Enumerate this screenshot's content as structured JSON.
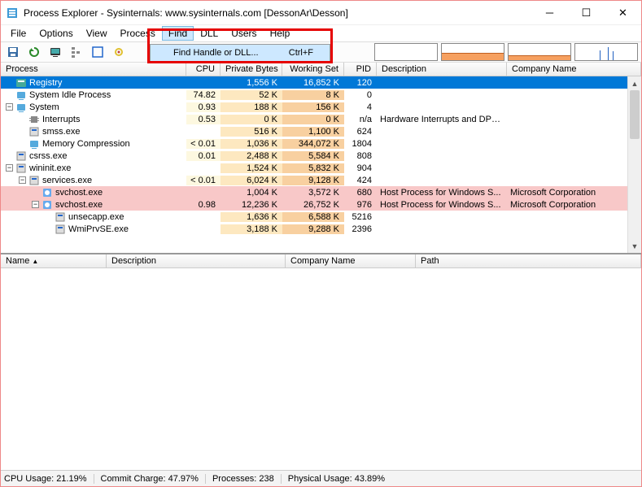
{
  "title": "Process Explorer - Sysinternals: www.sysinternals.com [DessonAr\\Desson]",
  "menu": {
    "file": "File",
    "options": "Options",
    "view": "View",
    "process": "Process",
    "find": "Find",
    "dll": "DLL",
    "users": "Users",
    "help": "Help"
  },
  "dropdown": {
    "label": "Find Handle or DLL...",
    "shortcut": "Ctrl+F"
  },
  "columns": {
    "process": "Process",
    "cpu": "CPU",
    "priv": "Private Bytes",
    "ws": "Working Set",
    "pid": "PID",
    "desc": "Description",
    "company": "Company Name"
  },
  "lower_cols": {
    "name": "Name",
    "desc": "Description",
    "company": "Company Name",
    "path": "Path"
  },
  "processes": [
    {
      "indent": 0,
      "exp": "",
      "name": "Registry",
      "cpu": "",
      "priv": "1,556 K",
      "ws": "16,852 K",
      "pid": "120",
      "desc": "",
      "company": "",
      "sel": true,
      "icon": "reg"
    },
    {
      "indent": 0,
      "exp": "",
      "name": "System Idle Process",
      "cpu": "74.82",
      "priv": "52 K",
      "ws": "8 K",
      "pid": "0",
      "desc": "",
      "company": "",
      "icon": "sys"
    },
    {
      "indent": 0,
      "exp": "-",
      "name": "System",
      "cpu": "0.93",
      "priv": "188 K",
      "ws": "156 K",
      "pid": "4",
      "desc": "",
      "company": "",
      "icon": "sys"
    },
    {
      "indent": 1,
      "exp": "",
      "name": "Interrupts",
      "cpu": "0.53",
      "priv": "0 K",
      "ws": "0 K",
      "pid": "n/a",
      "desc": "Hardware Interrupts and DPCs",
      "company": "",
      "icon": "int"
    },
    {
      "indent": 1,
      "exp": "",
      "name": "smss.exe",
      "cpu": "",
      "priv": "516 K",
      "ws": "1,100 K",
      "pid": "624",
      "desc": "",
      "company": "",
      "icon": "exe"
    },
    {
      "indent": 1,
      "exp": "",
      "name": "Memory Compression",
      "cpu": "< 0.01",
      "priv": "1,036 K",
      "ws": "344,072 K",
      "pid": "1804",
      "desc": "",
      "company": "",
      "icon": "sys"
    },
    {
      "indent": 0,
      "exp": "",
      "name": "csrss.exe",
      "cpu": "0.01",
      "priv": "2,488 K",
      "ws": "5,584 K",
      "pid": "808",
      "desc": "",
      "company": "",
      "icon": "exe"
    },
    {
      "indent": 0,
      "exp": "-",
      "name": "wininit.exe",
      "cpu": "",
      "priv": "1,524 K",
      "ws": "5,832 K",
      "pid": "904",
      "desc": "",
      "company": "",
      "icon": "exe"
    },
    {
      "indent": 1,
      "exp": "-",
      "name": "services.exe",
      "cpu": "< 0.01",
      "priv": "6,024 K",
      "ws": "9,128 K",
      "pid": "424",
      "desc": "",
      "company": "",
      "icon": "exe"
    },
    {
      "indent": 2,
      "exp": "",
      "name": "svchost.exe",
      "cpu": "",
      "priv": "1,004 K",
      "ws": "3,572 K",
      "pid": "680",
      "desc": "Host Process for Windows S...",
      "company": "Microsoft Corporation",
      "pink": true,
      "icon": "svc"
    },
    {
      "indent": 2,
      "exp": "-",
      "name": "svchost.exe",
      "cpu": "0.98",
      "priv": "12,236 K",
      "ws": "26,752 K",
      "pid": "976",
      "desc": "Host Process for Windows S...",
      "company": "Microsoft Corporation",
      "pink": true,
      "icon": "svc"
    },
    {
      "indent": 3,
      "exp": "",
      "name": "unsecapp.exe",
      "cpu": "",
      "priv": "1,636 K",
      "ws": "6,588 K",
      "pid": "5216",
      "desc": "",
      "company": "",
      "icon": "exe"
    },
    {
      "indent": 3,
      "exp": "",
      "name": "WmiPrvSE.exe",
      "cpu": "",
      "priv": "3,188 K",
      "ws": "9,288 K",
      "pid": "2396",
      "desc": "",
      "company": "",
      "icon": "exe"
    }
  ],
  "status": {
    "cpu": "CPU Usage: 21.19%",
    "commit": "Commit Charge: 47.97%",
    "proc": "Processes: 238",
    "phys": "Physical Usage: 43.89%"
  },
  "colw": {
    "process": 228,
    "cpu": 42,
    "priv": 76,
    "ws": 76,
    "pid": 40,
    "desc": 160,
    "company": 140
  },
  "lcolw": {
    "name": 130,
    "desc": 220,
    "company": 160,
    "path": 200
  }
}
